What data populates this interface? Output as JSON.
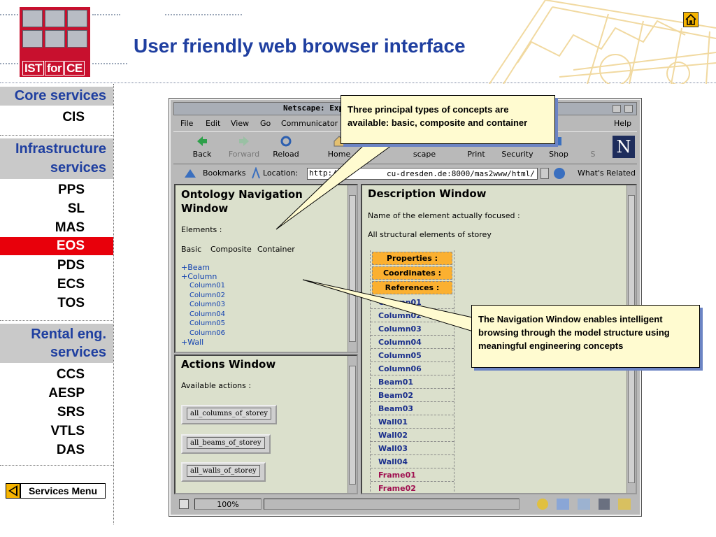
{
  "slide": {
    "title": "User friendly web browser interface",
    "logo": {
      "parts": [
        "IST",
        "for",
        "CE"
      ]
    }
  },
  "sidebar": {
    "core_services": "Core services",
    "core_items": [
      "CIS"
    ],
    "infrastructure": "Infrastructure services",
    "infrastructure_items": [
      "PPS",
      "SL",
      "MAS",
      "EOS",
      "PDS",
      "ECS",
      "TOS"
    ],
    "selected": "EOS",
    "rental": "Rental eng. services",
    "rental_items": [
      "CCS",
      "AESP",
      "SRS",
      "VTLS",
      "DAS"
    ],
    "services_menu": "Services Menu"
  },
  "browser": {
    "title": "Netscape: Exp",
    "menu": [
      "File",
      "Edit",
      "View",
      "Go",
      "Communicator",
      "Help"
    ],
    "toolbar": [
      "Back",
      "Forward",
      "Reload",
      "Home",
      "S",
      "scape",
      "Print",
      "Security",
      "Shop",
      "S"
    ],
    "bookmarks": "Bookmarks",
    "location_label": "Location:",
    "url": "http://b",
    "url_tail": "cu-dresden.de:8000/mas2www/html/",
    "whats_related": "What's Related",
    "status_zoom": "100%"
  },
  "ontology": {
    "title": "Ontology Navigation Window",
    "elements_label": "Elements :",
    "tabs": [
      "Basic",
      "Composite",
      "Container"
    ],
    "tree": [
      {
        "label": "+Beam",
        "indent": 0
      },
      {
        "label": "+Column",
        "indent": 0
      },
      {
        "label": "Column01",
        "indent": 1
      },
      {
        "label": "Column02",
        "indent": 1
      },
      {
        "label": "Column03",
        "indent": 1
      },
      {
        "label": "Column04",
        "indent": 1
      },
      {
        "label": "Column05",
        "indent": 1
      },
      {
        "label": "Column06",
        "indent": 1
      },
      {
        "label": "+Wall",
        "indent": 0
      }
    ]
  },
  "actions": {
    "title": "Actions Window",
    "label": "Available actions :",
    "buttons": [
      "all_columns_of_storey",
      "all_beams_of_storey",
      "all_walls_of_storey"
    ]
  },
  "description": {
    "title": "Description Window",
    "focus_label": "Name of the element actually focused :",
    "focus_value": "All structural elements of storey",
    "headers": [
      "Properties :",
      "Coordinates :",
      "References :"
    ],
    "rows": [
      "Column01",
      "Column02",
      "Column03",
      "Column04",
      "Column05",
      "Column06",
      "Beam01",
      "Beam02",
      "Beam03",
      "Wall01",
      "Wall02",
      "Wall03",
      "Wall04",
      "Frame01",
      "Frame02"
    ]
  },
  "callouts": {
    "concepts": "Three principal types of concepts are available: basic, composite and container",
    "navigation": "The Navigation Window enables intelligent browsing through the model structure using meaningful engineering concepts"
  }
}
